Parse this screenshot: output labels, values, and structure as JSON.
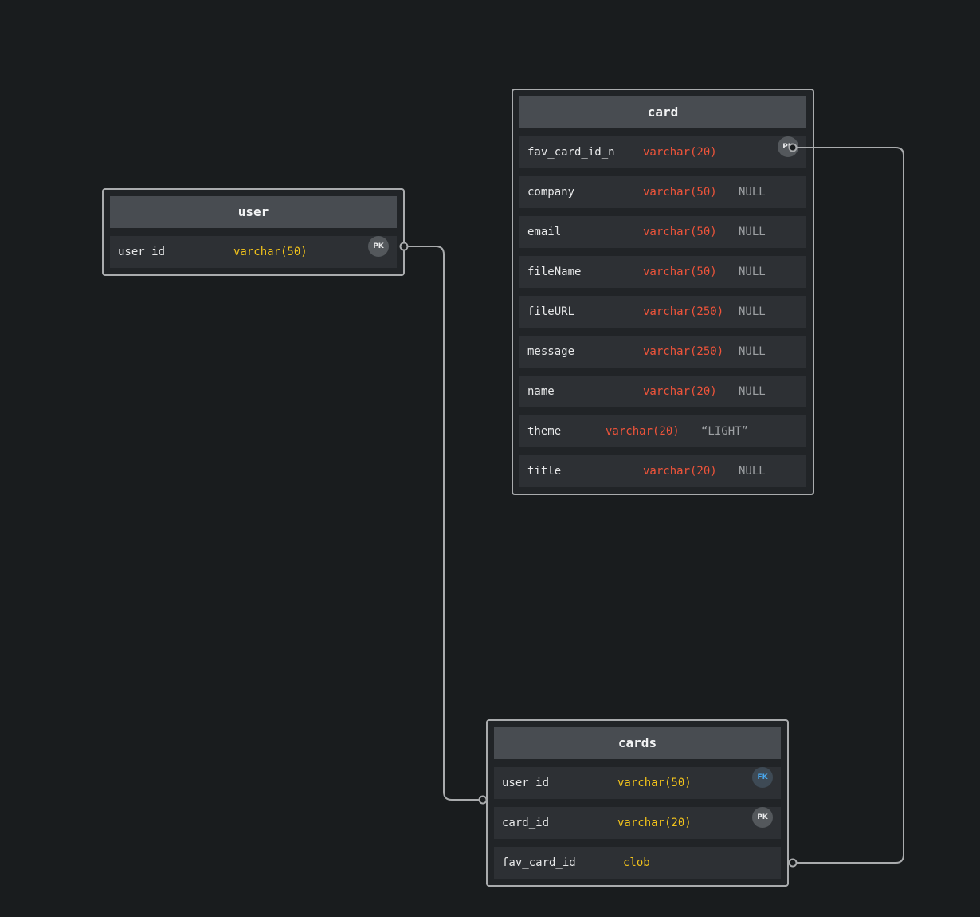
{
  "tables": {
    "user": {
      "name": "user",
      "columns": [
        {
          "name": "user_id",
          "type": "varchar(50)",
          "key": "PK"
        }
      ]
    },
    "card": {
      "name": "card",
      "columns": [
        {
          "name": "fav_card_id_n",
          "type": "varchar(20)",
          "key": "PK"
        },
        {
          "name": "company",
          "type": "varchar(50)",
          "default": "NULL"
        },
        {
          "name": "email",
          "type": "varchar(50)",
          "default": "NULL"
        },
        {
          "name": "fileName",
          "type": "varchar(50)",
          "default": "NULL"
        },
        {
          "name": "fileURL",
          "type": "varchar(250)",
          "default": "NULL"
        },
        {
          "name": "message",
          "type": "varchar(250)",
          "default": "NULL"
        },
        {
          "name": "name",
          "type": "varchar(20)",
          "default": "NULL"
        },
        {
          "name": "theme",
          "type": "varchar(20)",
          "default": "“LIGHT”"
        },
        {
          "name": "title",
          "type": "varchar(20)",
          "default": "NULL"
        }
      ]
    },
    "cards": {
      "name": "cards",
      "columns": [
        {
          "name": "user_id",
          "type": "varchar(50)",
          "key": "FK"
        },
        {
          "name": "card_id",
          "type": "varchar(20)",
          "key": "PK"
        },
        {
          "name": "fav_card_id",
          "type": "clob"
        }
      ]
    }
  },
  "relationships": [
    {
      "from": "user.user_id",
      "to": "cards.user_id"
    },
    {
      "from": "card.fav_card_id_n",
      "to": "cards.fav_card_id"
    }
  ],
  "colors": {
    "background": "#191c1e",
    "type_red": "#f0543a",
    "type_yellow": "#f1c21b",
    "connector": "#a9abad",
    "fk_badge": "#4aa8ee"
  }
}
